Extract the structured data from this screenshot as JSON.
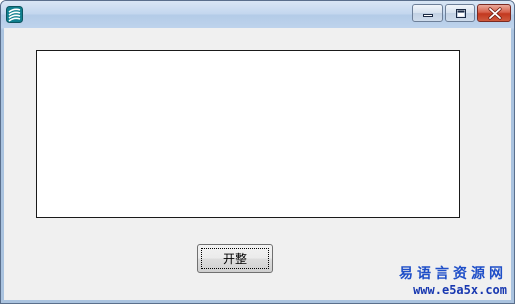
{
  "window": {
    "title": "",
    "icon": "app-logo-icon",
    "controls": {
      "minimize_icon": "minimize-icon",
      "maximize_icon": "maximize-icon",
      "close_icon": "close-icon"
    }
  },
  "content": {
    "textbox_value": "",
    "start_button_label": "开整"
  },
  "watermark": {
    "title": "易语言资源网",
    "url": "www.e5a5x.com"
  },
  "colors": {
    "titlebar": "#c2d6ee",
    "client_background": "#f0f0f0",
    "close_button": "#c2381f",
    "watermark": "#1f4fc8"
  }
}
